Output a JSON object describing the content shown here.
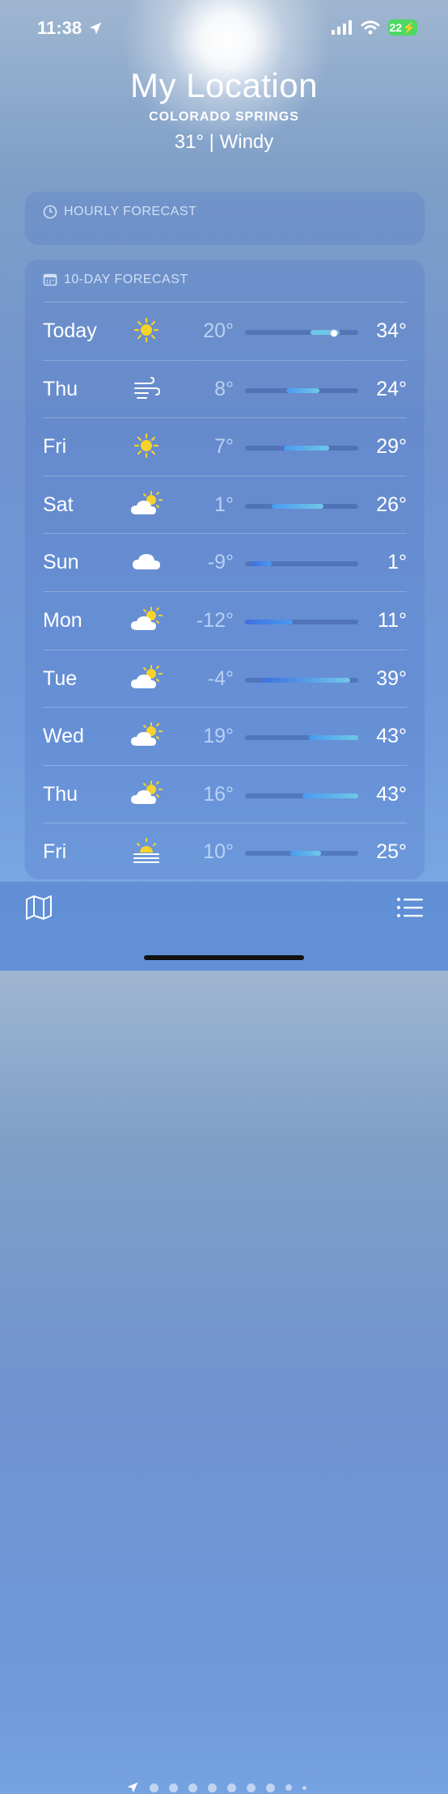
{
  "status_bar": {
    "time": "11:38",
    "battery": "22",
    "icons": [
      "location-arrow-icon",
      "signal-bars-icon",
      "wifi-icon",
      "battery-charging-icon"
    ]
  },
  "header": {
    "title": "My Location",
    "subtitle": "COLORADO SPRINGS",
    "current": "31°  |  Windy"
  },
  "hourly": {
    "title": "HOURLY FORECAST",
    "icon": "clock-icon"
  },
  "ten_day": {
    "title": "10-DAY FORECAST",
    "icon": "calendar-icon",
    "scale": {
      "min": -12,
      "max": 43
    },
    "days": [
      {
        "day": "Today",
        "icon": "sun-icon",
        "low": "20°",
        "high": "34°",
        "low_val": 20,
        "high_val": 34,
        "current_val": 31
      },
      {
        "day": "Thu",
        "icon": "wind-icon",
        "low": "8°",
        "high": "24°",
        "low_val": 8,
        "high_val": 24
      },
      {
        "day": "Fri",
        "icon": "sun-icon",
        "low": "7°",
        "high": "29°",
        "low_val": 7,
        "high_val": 29
      },
      {
        "day": "Sat",
        "icon": "partly-sunny-icon",
        "low": "1°",
        "high": "26°",
        "low_val": 1,
        "high_val": 26
      },
      {
        "day": "Sun",
        "icon": "cloud-icon",
        "low": "-9°",
        "high": "1°",
        "low_val": -9,
        "high_val": 1
      },
      {
        "day": "Mon",
        "icon": "partly-sunny-icon",
        "low": "-12°",
        "high": "11°",
        "low_val": -12,
        "high_val": 11
      },
      {
        "day": "Tue",
        "icon": "partly-sunny-icon",
        "low": "-4°",
        "high": "39°",
        "low_val": -4,
        "high_val": 39
      },
      {
        "day": "Wed",
        "icon": "partly-sunny-icon",
        "low": "19°",
        "high": "43°",
        "low_val": 19,
        "high_val": 43
      },
      {
        "day": "Thu",
        "icon": "partly-sunny-icon",
        "low": "16°",
        "high": "43°",
        "low_val": 16,
        "high_val": 43
      },
      {
        "day": "Fri",
        "icon": "sunrise-haze-icon",
        "low": "10°",
        "high": "25°",
        "low_val": 10,
        "high_val": 25
      }
    ]
  },
  "bottom_bar": {
    "left_icon": "map-icon",
    "right_icon": "list-icon",
    "page_indicator": {
      "current_icon": "location-arrow-icon",
      "pages": 10
    }
  },
  "colors": {
    "cold": "#3f6fe0",
    "cool": "#4a9af0",
    "mild": "#6ec8e8",
    "sun": "#f7d22a"
  }
}
